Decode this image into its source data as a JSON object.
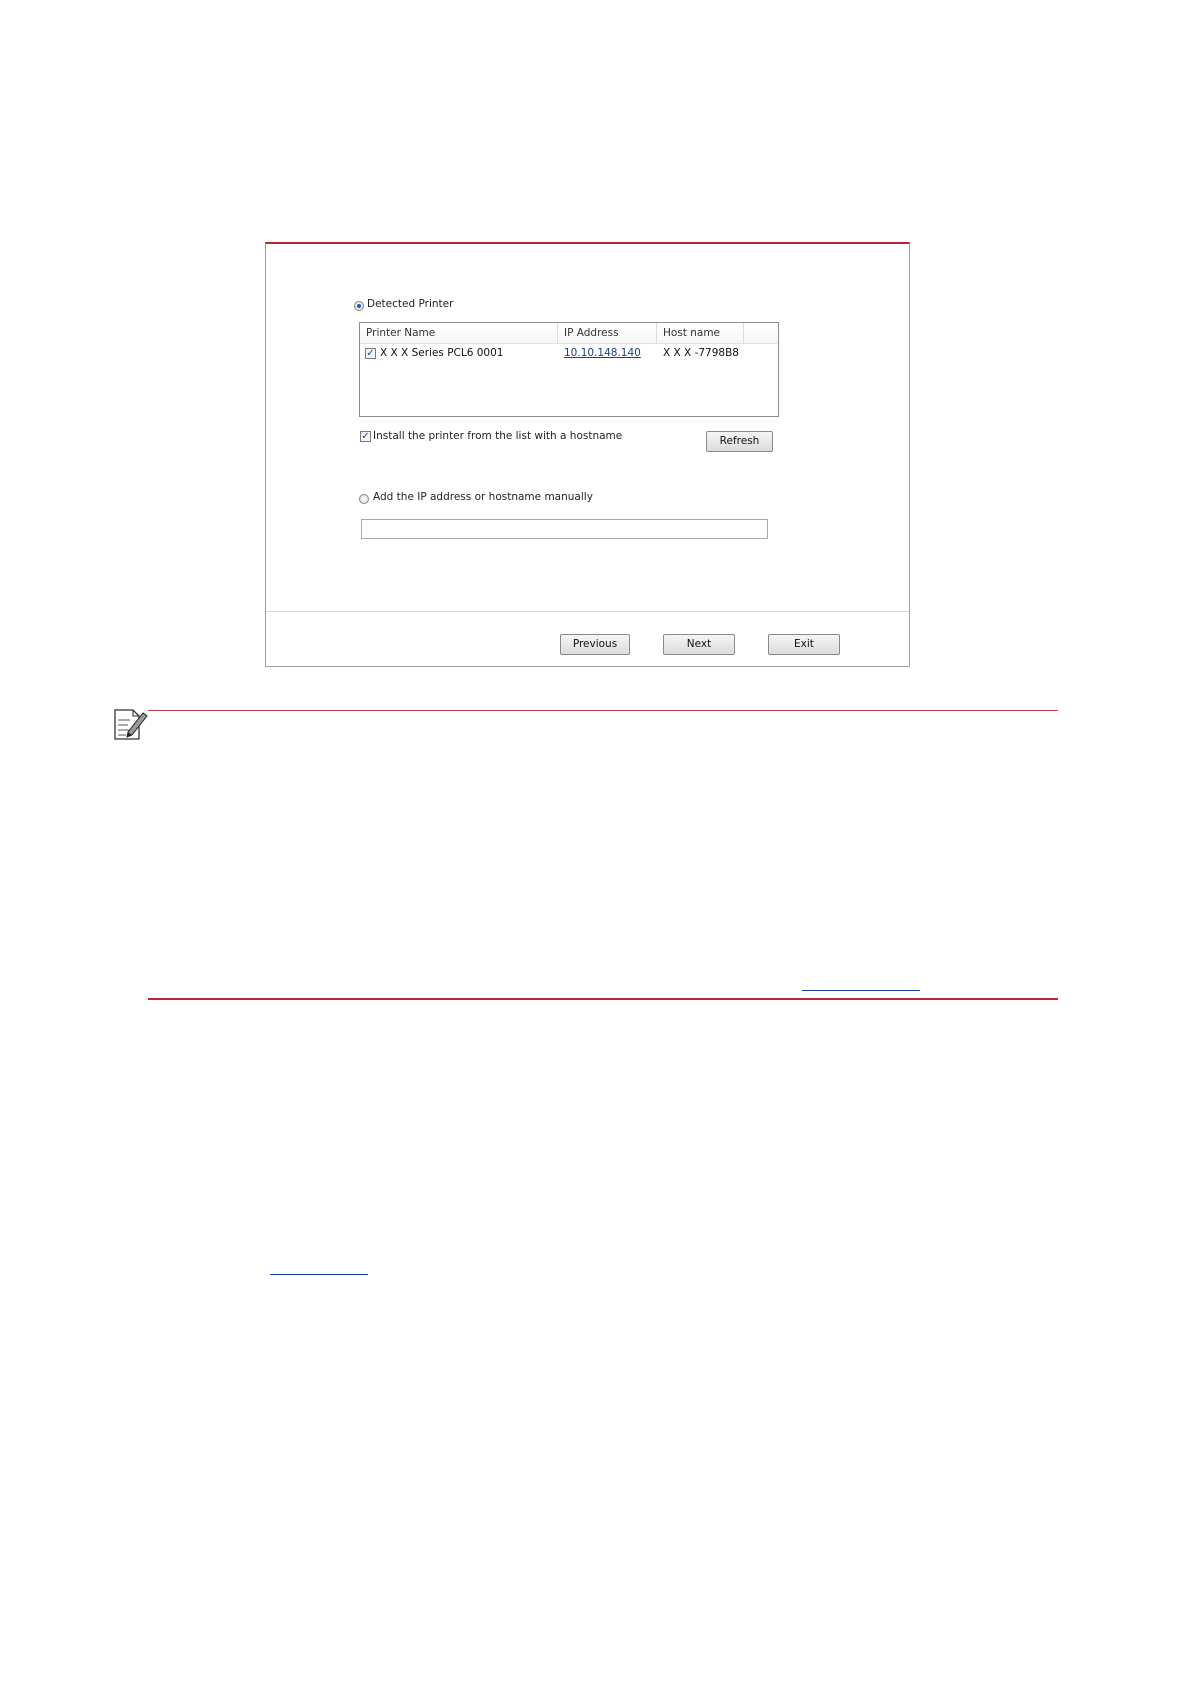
{
  "dialog": {
    "detected_label": "Detected Printer",
    "table": {
      "headers": [
        "Printer Name",
        "IP Address",
        "Host name"
      ],
      "rows": [
        {
          "checked": true,
          "name": "X X X  Series PCL6 0001",
          "ip": "10.10.148.140",
          "host": "X X X -7798B8"
        }
      ]
    },
    "install_hostname_label": "Install the printer from the list with a hostname",
    "refresh_label": "Refresh",
    "manual_label": "Add the IP address or hostname manually",
    "manual_value": "",
    "buttons": {
      "previous": "Previous",
      "next": "Next",
      "exit": "Exit"
    },
    "check_mark": "✓",
    "detected_selected": true,
    "manual_selected": false,
    "install_hostname_checked": true
  },
  "icons": [
    "radio-selected-icon",
    "checkbox-checked-icon",
    "note-pencil-icon"
  ],
  "colors": {
    "accent_red": "#c0232c",
    "link_blue": "#1a3aa0"
  }
}
